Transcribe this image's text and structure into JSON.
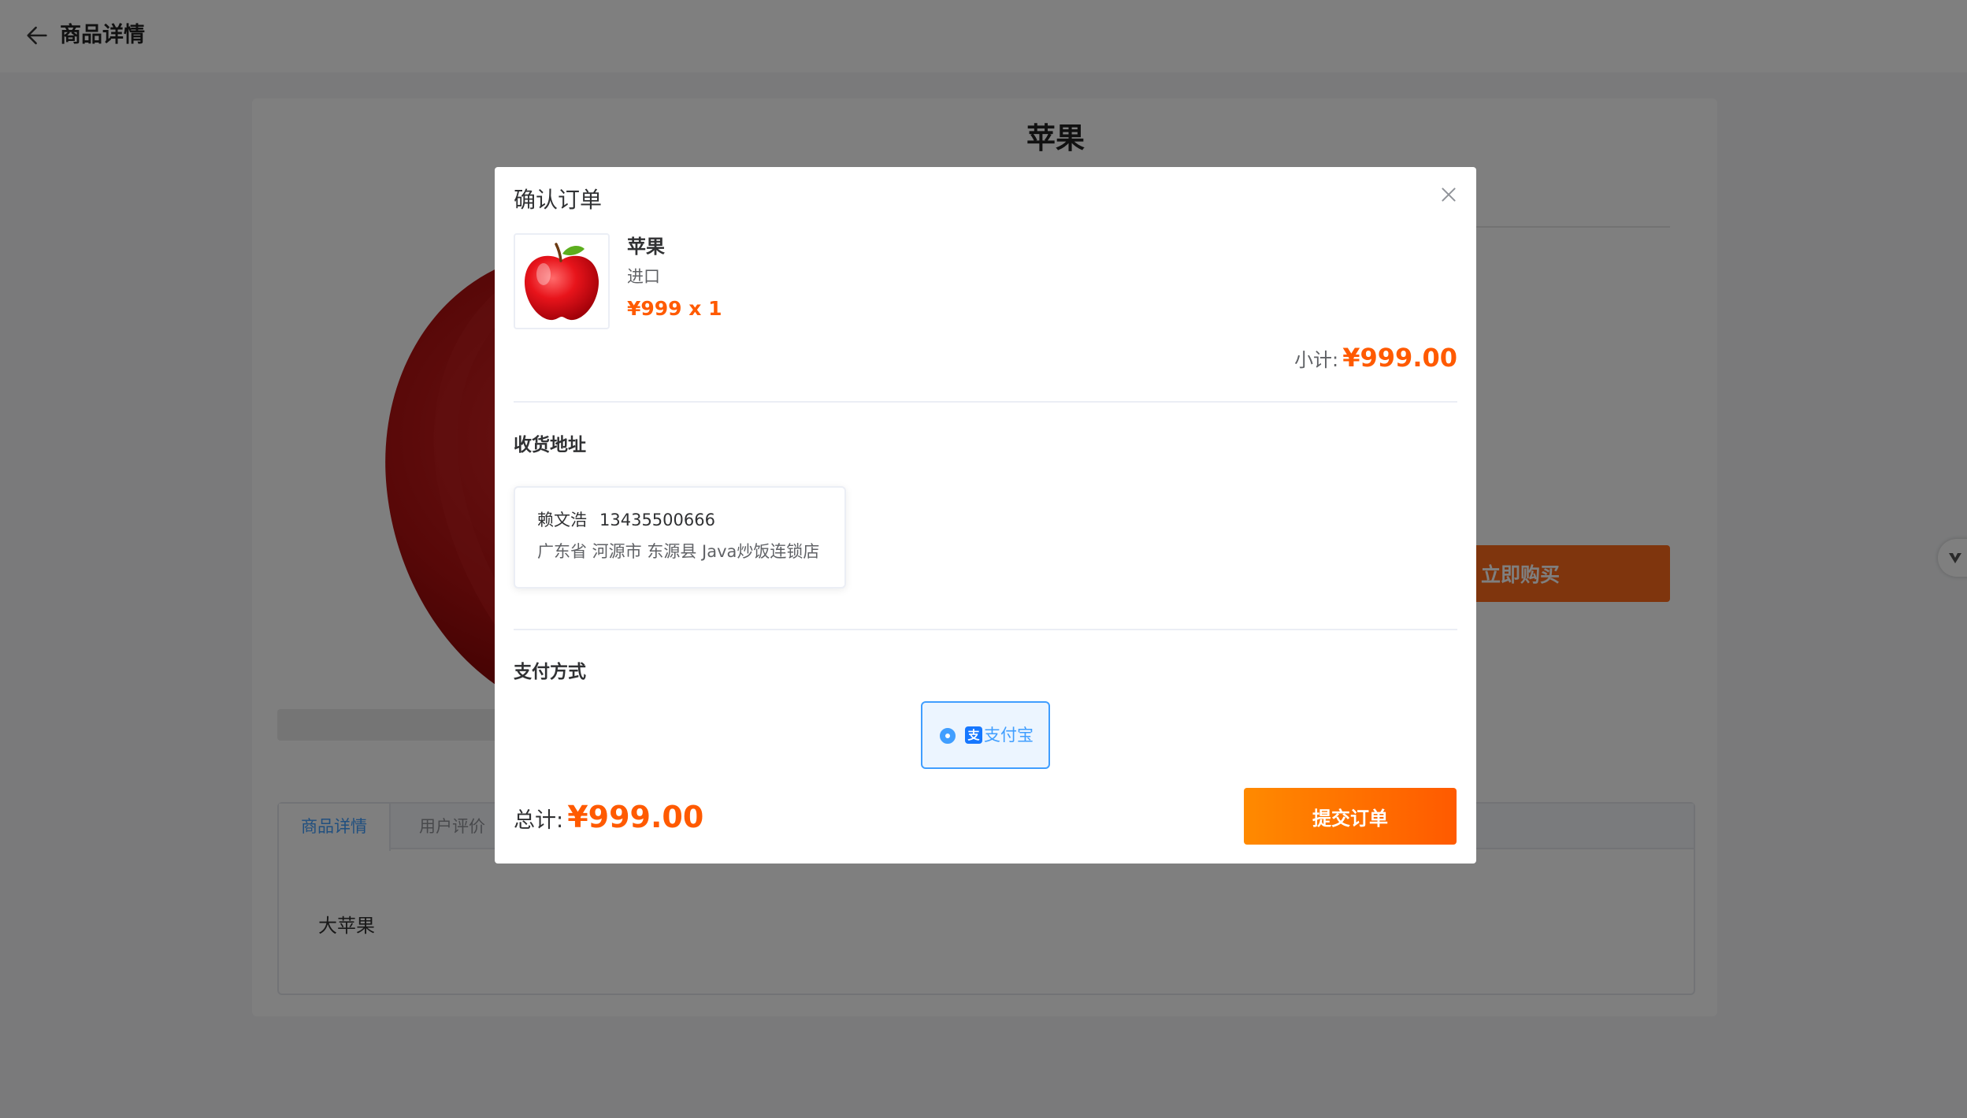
{
  "header": {
    "title": "商品详情"
  },
  "product_page": {
    "title": "苹果",
    "buy_now_label": "立即购买",
    "tabs": [
      {
        "label": "商品详情"
      },
      {
        "label": "用户评价"
      }
    ],
    "description": "大苹果"
  },
  "dialog": {
    "title": "确认订单",
    "item": {
      "name": "苹果",
      "spec": "进口",
      "price_qty": "¥999 x 1"
    },
    "subtotal_label": "小计:",
    "subtotal_value": "¥999.00",
    "address_section_title": "收货地址",
    "address": {
      "name": "赖文浩",
      "phone": "13435500666",
      "detail": "广东省 河源市 东源县 Java炒饭连锁店"
    },
    "payment_section_title": "支付方式",
    "payment_option": "支付宝",
    "total_label": "总计:",
    "total_value": "¥999.00",
    "submit_label": "提交订单"
  },
  "colors": {
    "accent_orange": "#ff5a00",
    "accent_blue": "#409eff",
    "overlay": "rgba(0,0,0,0.5)"
  },
  "icons": {
    "back": "arrow-left-icon",
    "close": "close-icon",
    "alipay": "alipay-icon",
    "side_float": "chevron-down-icon"
  }
}
